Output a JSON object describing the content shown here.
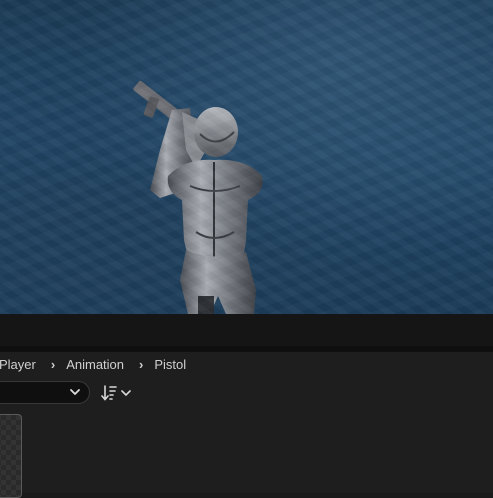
{
  "viewport": {
    "scene": "character-aiming-pistol"
  },
  "breadcrumb": {
    "items": [
      "Player",
      "Animation",
      "Pistol"
    ]
  },
  "toolbar": {
    "filter_value": "",
    "icons": {
      "dropdown": "chevron-down-icon",
      "sort": "sort-icon"
    }
  },
  "colors": {
    "viewport_bg": "#234a6b",
    "panel_bg": "#1e1e1e",
    "text": "#d0d0d0"
  }
}
